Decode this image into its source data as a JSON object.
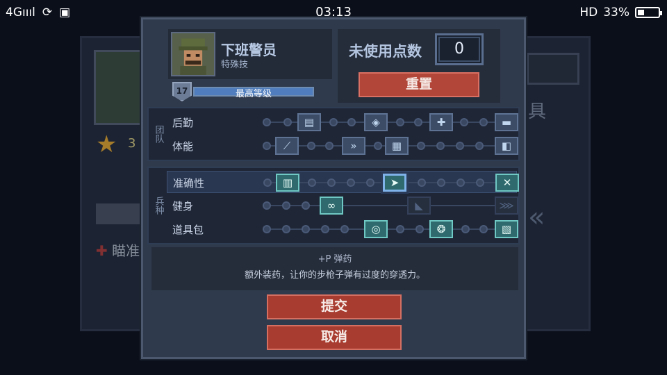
{
  "status_bar": {
    "network": "4Gıııl",
    "time": "03:13",
    "hd": "HD",
    "battery": "33%",
    "battery_level": 0.33
  },
  "background": {
    "star_count": "3",
    "right_text": "具",
    "aim_label": "瞄准",
    "aim_icon": "x-mark-icon"
  },
  "hero": {
    "name": "下班警员",
    "class": "特殊技",
    "level": "17",
    "level_label": "最高等级",
    "level_fill": 1.0
  },
  "points": {
    "label": "未使用点数",
    "value": "0",
    "reset_label": "重置"
  },
  "sections": {
    "team": {
      "label": "团队",
      "rows": [
        {
          "label": "后勤",
          "icons": [
            "supply-icon",
            "shield-plus-icon",
            "medkit-icon",
            "bed-icon"
          ]
        },
        {
          "label": "体能",
          "icons": [
            "knife-icon",
            "sprint-icon",
            "crate-icon",
            "armor-icon"
          ]
        }
      ]
    },
    "class": {
      "label": "兵种",
      "rows": [
        {
          "label": "准确性",
          "icons": [
            "vest-icon",
            "bullet-icon",
            "crosshair-icon"
          ]
        },
        {
          "label": "健身",
          "icons": [
            "chain-icon",
            "mortar-icon",
            "wing-icon"
          ]
        },
        {
          "label": "道具包",
          "icons": [
            "scope-icon",
            "grenade-icon",
            "ammo-box-icon"
          ]
        }
      ]
    }
  },
  "description": {
    "title": "+P 弹药",
    "body": "额外装药，让你的步枪子弹有过度的穿透力。"
  },
  "buttons": {
    "submit": "提交",
    "cancel": "取消"
  }
}
